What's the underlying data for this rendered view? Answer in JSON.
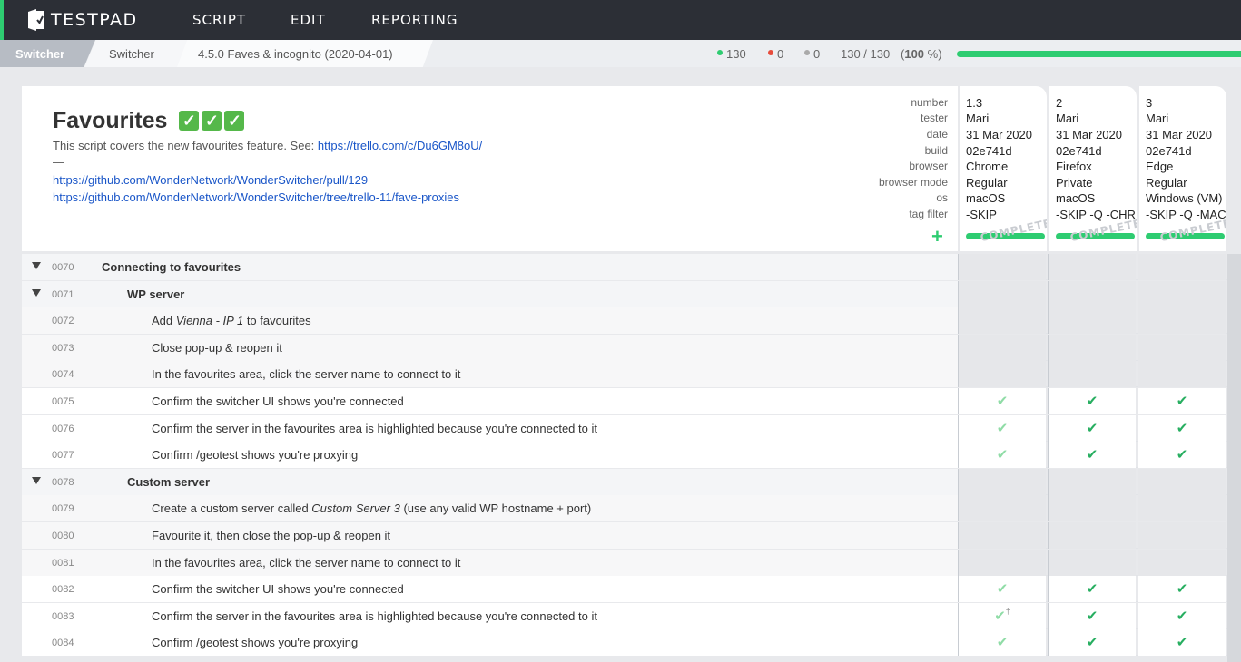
{
  "app": {
    "name": "TESTPAD",
    "nav": [
      "SCRIPT",
      "EDIT",
      "REPORTING"
    ]
  },
  "breadcrumb": {
    "active": "Switcher",
    "folder": "Switcher",
    "script": "4.5.0 Faves & incognito (2020-04-01)"
  },
  "stats": {
    "pass": "130",
    "fail": "0",
    "other": "0",
    "progress_text": "130 / 130",
    "percent": "100",
    "percent_suffix": "%",
    "progress_fraction": 1.0,
    "colors": {
      "pass": "#2ecc71",
      "fail": "#e74c3c",
      "other": "#aaaaaa"
    }
  },
  "script": {
    "title": "Favourites",
    "title_checks": 3,
    "description": "This script covers the new favourites feature. See: ",
    "description_link": "https://trello.com/c/Du6GM8oU/",
    "dash": "—",
    "link1": "https://github.com/WonderNetwork/WonderSwitcher/pull/129",
    "link2": "https://github.com/WonderNetwork/WonderSwitcher/tree/trello-11/fave-proxies"
  },
  "run_labels": [
    "number",
    "tester",
    "date",
    "build",
    "browser",
    "browser mode",
    "os",
    "tag filter"
  ],
  "runs": [
    {
      "values": [
        "1.3",
        "Mari",
        "31 Mar 2020",
        "02e741d",
        "Chrome",
        "Regular",
        "macOS",
        "-SKIP"
      ],
      "stamp": "COMPLETE"
    },
    {
      "values": [
        "2",
        "Mari",
        "31 Mar 2020",
        "02e741d",
        "Firefox",
        "Private",
        "macOS",
        "-SKIP -Q -CHR"
      ],
      "stamp": "COMPLETE"
    },
    {
      "values": [
        "3",
        "Mari",
        "31 Mar 2020",
        "02e741d",
        "Edge",
        "Regular",
        "Windows (VM)",
        "-SKIP -Q -MAC"
      ],
      "stamp": "COMPLETE"
    }
  ],
  "rows": [
    {
      "num": "0070",
      "text": "Connecting to favourites",
      "level": 0,
      "heading": true
    },
    {
      "num": "0071",
      "text": "WP server",
      "level": 1,
      "heading": true
    },
    {
      "num": "0072",
      "parts": [
        "Add ",
        "Vienna - IP 1",
        " to favourites"
      ],
      "level": 2
    },
    {
      "num": "0073",
      "text": "Close pop-up & reopen it",
      "level": 2
    },
    {
      "num": "0074",
      "text": "In the favourites area, click the server name to connect to it",
      "level": 2
    },
    {
      "num": "0075",
      "text": "Confirm the switcher UI shows you're connected",
      "level": 2,
      "results": [
        "pass-light",
        "pass",
        "pass"
      ]
    },
    {
      "num": "0076",
      "text": "Confirm the server in the favourites area is highlighted because you're connected to it",
      "level": 2,
      "results": [
        "pass-light",
        "pass",
        "pass"
      ]
    },
    {
      "num": "0077",
      "text": "Confirm /geotest shows you're proxying",
      "level": 2,
      "results": [
        "pass-light",
        "pass",
        "pass"
      ]
    },
    {
      "num": "0078",
      "text": "Custom server",
      "level": 1,
      "heading": true
    },
    {
      "num": "0079",
      "parts": [
        "Create a custom server called ",
        "Custom Server 3",
        " (use any valid WP hostname + port)"
      ],
      "level": 2
    },
    {
      "num": "0080",
      "text": "Favourite it, then close the pop-up & reopen it",
      "level": 2
    },
    {
      "num": "0081",
      "text": "In the favourites area, click the server name to connect to it",
      "level": 2
    },
    {
      "num": "0082",
      "text": "Confirm the switcher UI shows you're connected",
      "level": 2,
      "results": [
        "pass-light",
        "pass",
        "pass"
      ]
    },
    {
      "num": "0083",
      "text": "Confirm the server in the favourites area is highlighted because you're connected to it",
      "level": 2,
      "results": [
        "pass-light-note",
        "pass",
        "pass"
      ],
      "note_mark": "†"
    },
    {
      "num": "0084",
      "text": "Confirm /geotest shows you're proxying",
      "level": 2,
      "results": [
        "pass-light",
        "pass",
        "pass"
      ]
    }
  ],
  "icons": {
    "check": "✔",
    "expand": "triangle-down"
  }
}
